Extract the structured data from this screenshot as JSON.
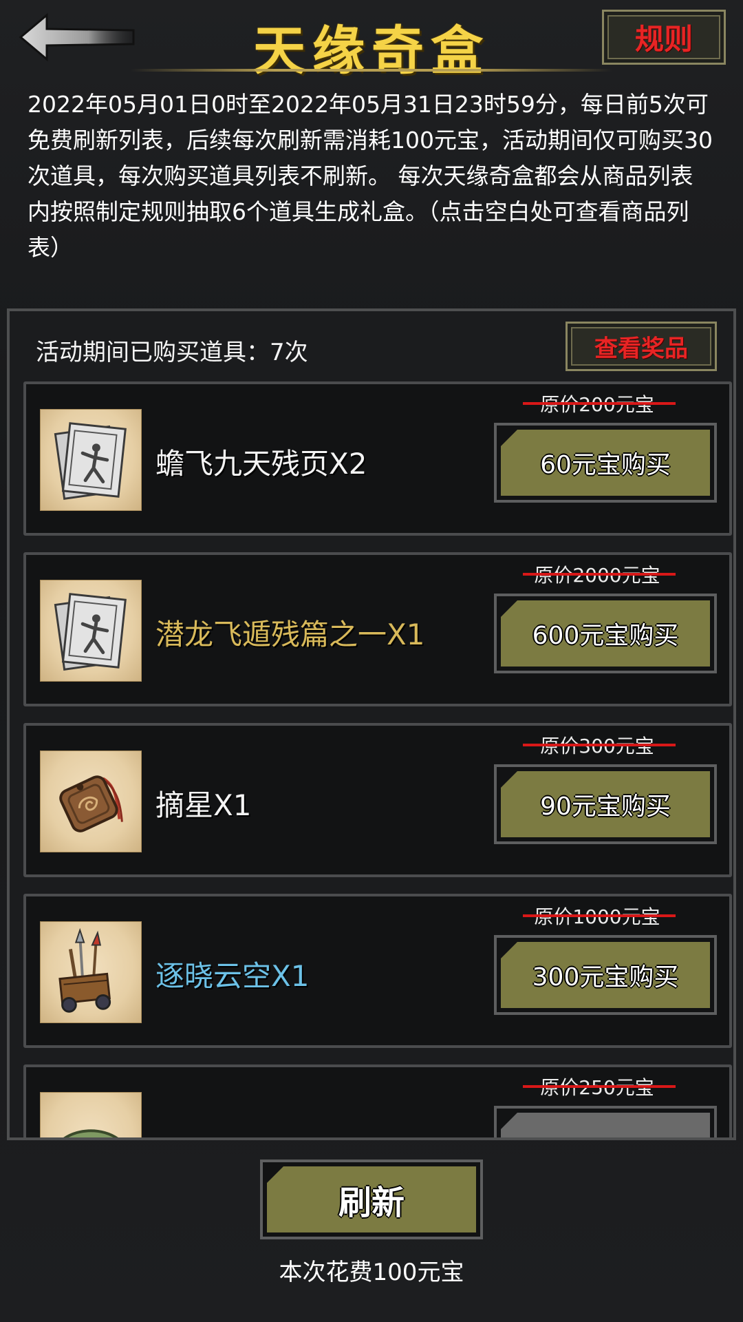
{
  "header": {
    "title": "天缘奇盒",
    "rules_label": "规则"
  },
  "description": "2022年05月01日0时至2022年05月31日23时59分，每日前5次可免费刷新列表，后续每次刷新需消耗100元宝，活动期间仅可购买30次道具，每次购买道具列表不刷新。 每次天缘奇盒都会从商品列表内按照制定规则抽取6个道具生成礼盒。（点击空白处可查看商品列表）",
  "panel": {
    "purchased_text": "活动期间已购买道具：7次",
    "view_prizes_label": "查看奖品"
  },
  "items": [
    {
      "name": "蟾飞九天残页X2",
      "original_price": "原价200元宝",
      "buy_label": "60元宝购买",
      "name_color": "white",
      "icon": "scroll-pages-icon"
    },
    {
      "name": "潜龙飞遁残篇之一X1",
      "original_price": "原价2000元宝",
      "buy_label": "600元宝购买",
      "name_color": "gold",
      "icon": "scroll-pages-icon"
    },
    {
      "name": "摘星X1",
      "original_price": "原价300元宝",
      "buy_label": "90元宝购买",
      "name_color": "white",
      "icon": "token-amulet-icon"
    },
    {
      "name": "逐晓云空X1",
      "original_price": "原价1000元宝",
      "buy_label": "300元宝购买",
      "name_color": "blue",
      "icon": "weapon-cart-icon"
    },
    {
      "name": "",
      "original_price": "原价250元宝",
      "buy_label": "",
      "name_color": "white",
      "icon": "green-orb-icon"
    }
  ],
  "footer": {
    "refresh_label": "刷新",
    "cost_text": "本次花费100元宝"
  },
  "colors": {
    "accent_gold": "#f5d347",
    "button_olive": "#7c7b42",
    "strike_red": "#d81818",
    "rare_gold": "#d8b95a",
    "rare_blue": "#6cc1e7"
  }
}
